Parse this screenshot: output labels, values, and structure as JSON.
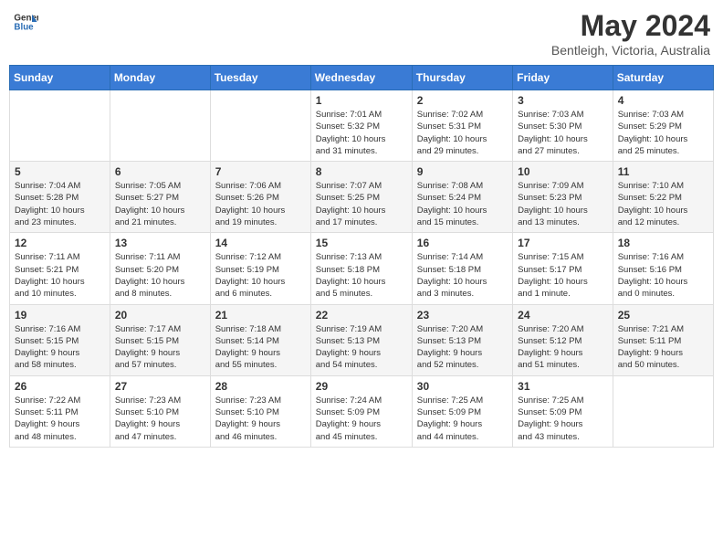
{
  "header": {
    "logo_general": "General",
    "logo_blue": "Blue",
    "month": "May 2024",
    "location": "Bentleigh, Victoria, Australia"
  },
  "weekdays": [
    "Sunday",
    "Monday",
    "Tuesday",
    "Wednesday",
    "Thursday",
    "Friday",
    "Saturday"
  ],
  "weeks": [
    [
      {
        "day": "",
        "info": ""
      },
      {
        "day": "",
        "info": ""
      },
      {
        "day": "",
        "info": ""
      },
      {
        "day": "1",
        "info": "Sunrise: 7:01 AM\nSunset: 5:32 PM\nDaylight: 10 hours\nand 31 minutes."
      },
      {
        "day": "2",
        "info": "Sunrise: 7:02 AM\nSunset: 5:31 PM\nDaylight: 10 hours\nand 29 minutes."
      },
      {
        "day": "3",
        "info": "Sunrise: 7:03 AM\nSunset: 5:30 PM\nDaylight: 10 hours\nand 27 minutes."
      },
      {
        "day": "4",
        "info": "Sunrise: 7:03 AM\nSunset: 5:29 PM\nDaylight: 10 hours\nand 25 minutes."
      }
    ],
    [
      {
        "day": "5",
        "info": "Sunrise: 7:04 AM\nSunset: 5:28 PM\nDaylight: 10 hours\nand 23 minutes."
      },
      {
        "day": "6",
        "info": "Sunrise: 7:05 AM\nSunset: 5:27 PM\nDaylight: 10 hours\nand 21 minutes."
      },
      {
        "day": "7",
        "info": "Sunrise: 7:06 AM\nSunset: 5:26 PM\nDaylight: 10 hours\nand 19 minutes."
      },
      {
        "day": "8",
        "info": "Sunrise: 7:07 AM\nSunset: 5:25 PM\nDaylight: 10 hours\nand 17 minutes."
      },
      {
        "day": "9",
        "info": "Sunrise: 7:08 AM\nSunset: 5:24 PM\nDaylight: 10 hours\nand 15 minutes."
      },
      {
        "day": "10",
        "info": "Sunrise: 7:09 AM\nSunset: 5:23 PM\nDaylight: 10 hours\nand 13 minutes."
      },
      {
        "day": "11",
        "info": "Sunrise: 7:10 AM\nSunset: 5:22 PM\nDaylight: 10 hours\nand 12 minutes."
      }
    ],
    [
      {
        "day": "12",
        "info": "Sunrise: 7:11 AM\nSunset: 5:21 PM\nDaylight: 10 hours\nand 10 minutes."
      },
      {
        "day": "13",
        "info": "Sunrise: 7:11 AM\nSunset: 5:20 PM\nDaylight: 10 hours\nand 8 minutes."
      },
      {
        "day": "14",
        "info": "Sunrise: 7:12 AM\nSunset: 5:19 PM\nDaylight: 10 hours\nand 6 minutes."
      },
      {
        "day": "15",
        "info": "Sunrise: 7:13 AM\nSunset: 5:18 PM\nDaylight: 10 hours\nand 5 minutes."
      },
      {
        "day": "16",
        "info": "Sunrise: 7:14 AM\nSunset: 5:18 PM\nDaylight: 10 hours\nand 3 minutes."
      },
      {
        "day": "17",
        "info": "Sunrise: 7:15 AM\nSunset: 5:17 PM\nDaylight: 10 hours\nand 1 minute."
      },
      {
        "day": "18",
        "info": "Sunrise: 7:16 AM\nSunset: 5:16 PM\nDaylight: 10 hours\nand 0 minutes."
      }
    ],
    [
      {
        "day": "19",
        "info": "Sunrise: 7:16 AM\nSunset: 5:15 PM\nDaylight: 9 hours\nand 58 minutes."
      },
      {
        "day": "20",
        "info": "Sunrise: 7:17 AM\nSunset: 5:15 PM\nDaylight: 9 hours\nand 57 minutes."
      },
      {
        "day": "21",
        "info": "Sunrise: 7:18 AM\nSunset: 5:14 PM\nDaylight: 9 hours\nand 55 minutes."
      },
      {
        "day": "22",
        "info": "Sunrise: 7:19 AM\nSunset: 5:13 PM\nDaylight: 9 hours\nand 54 minutes."
      },
      {
        "day": "23",
        "info": "Sunrise: 7:20 AM\nSunset: 5:13 PM\nDaylight: 9 hours\nand 52 minutes."
      },
      {
        "day": "24",
        "info": "Sunrise: 7:20 AM\nSunset: 5:12 PM\nDaylight: 9 hours\nand 51 minutes."
      },
      {
        "day": "25",
        "info": "Sunrise: 7:21 AM\nSunset: 5:11 PM\nDaylight: 9 hours\nand 50 minutes."
      }
    ],
    [
      {
        "day": "26",
        "info": "Sunrise: 7:22 AM\nSunset: 5:11 PM\nDaylight: 9 hours\nand 48 minutes."
      },
      {
        "day": "27",
        "info": "Sunrise: 7:23 AM\nSunset: 5:10 PM\nDaylight: 9 hours\nand 47 minutes."
      },
      {
        "day": "28",
        "info": "Sunrise: 7:23 AM\nSunset: 5:10 PM\nDaylight: 9 hours\nand 46 minutes."
      },
      {
        "day": "29",
        "info": "Sunrise: 7:24 AM\nSunset: 5:09 PM\nDaylight: 9 hours\nand 45 minutes."
      },
      {
        "day": "30",
        "info": "Sunrise: 7:25 AM\nSunset: 5:09 PM\nDaylight: 9 hours\nand 44 minutes."
      },
      {
        "day": "31",
        "info": "Sunrise: 7:25 AM\nSunset: 5:09 PM\nDaylight: 9 hours\nand 43 minutes."
      },
      {
        "day": "",
        "info": ""
      }
    ]
  ]
}
